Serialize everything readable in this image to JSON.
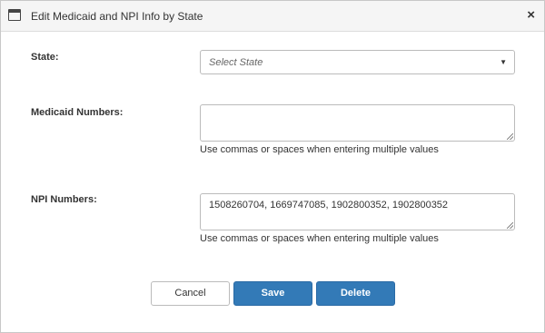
{
  "dialog": {
    "title": "Edit Medicaid and NPI Info by State",
    "close_symbol": "×"
  },
  "state": {
    "label": "State:",
    "placeholder": "Select State",
    "caret_symbol": "▼"
  },
  "medicaid": {
    "label": "Medicaid Numbers:",
    "value": "",
    "hint": "Use commas or spaces when entering multiple values"
  },
  "npi": {
    "label": "NPI Numbers:",
    "value": "1508260704, 1669747085, 1902800352, 1902800352",
    "hint": "Use commas or spaces when entering multiple values"
  },
  "buttons": {
    "cancel": "Cancel",
    "save": "Save",
    "delete": "Delete"
  },
  "colors": {
    "primary": "#337ab7",
    "titlebar": "#f5f5f5"
  },
  "icons": {
    "title": "window-icon",
    "close": "close-icon",
    "dropdown": "chevron-down-icon"
  }
}
